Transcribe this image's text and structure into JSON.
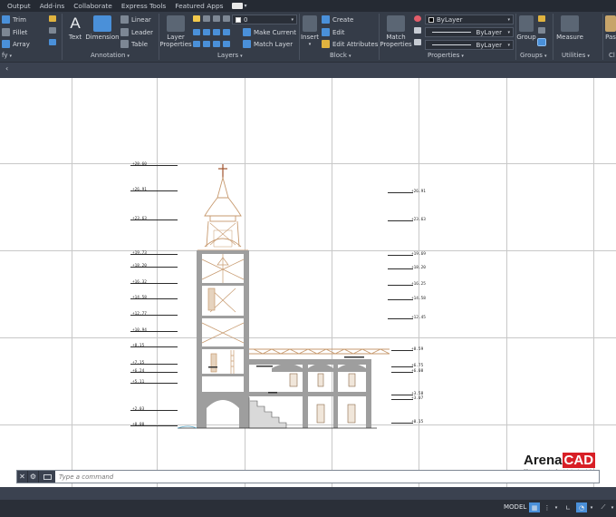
{
  "menu": {
    "tabs": [
      "Output",
      "Add-ins",
      "Collaborate",
      "Express Tools",
      "Featured Apps"
    ]
  },
  "ribbon": {
    "modify": {
      "label": "fy",
      "items": [
        "Trim",
        "Fillet",
        "Array"
      ]
    },
    "annotation": {
      "label": "Annotation",
      "text_label": "Text",
      "dimension_label": "Dimension",
      "items": [
        "Linear",
        "Leader",
        "Table"
      ]
    },
    "layers": {
      "label": "Layers",
      "layer_properties_label": "Layer\nProperties",
      "layer_value": "0",
      "make_current_label": "Make Current",
      "match_layer_label": "Match Layer"
    },
    "block": {
      "label": "Block",
      "insert_label": "Insert",
      "items": [
        "Create",
        "Edit",
        "Edit Attributes"
      ]
    },
    "properties": {
      "label": "Properties",
      "match_properties_label": "Match\nProperties",
      "color_value": "ByLayer",
      "linetype_value": "ByLayer",
      "lineweight_value": "ByLayer"
    },
    "groups": {
      "label": "Groups",
      "group_label": "Group"
    },
    "utilities": {
      "label": "Utilities",
      "measure_label": "Measure"
    },
    "clipboard": {
      "label": "Cl",
      "paste_label": "Pas"
    }
  },
  "drawing": {
    "elevations_left": [
      "+28.60",
      "+26.91",
      "+23.63",
      "+19.73",
      "+18.20",
      "+16.32",
      "+14.58",
      "+12.77",
      "+10.94",
      "+8.15",
      "+7.15",
      "+6.24",
      "+5.11",
      "+2.03",
      "+0.00"
    ],
    "elevations_right": [
      "+26.91",
      "+23.63",
      "+19.69",
      "+18.20",
      "+16.25",
      "+14.58",
      "+12.45",
      "+8.59",
      "+6.75",
      "+6.08",
      "+3.58",
      "+3.07",
      "+0.15"
    ]
  },
  "command_line": {
    "placeholder": "Type a command"
  },
  "logo": {
    "brand_part_1": "Arena",
    "brand_part_2": "CAD",
    "tagline": "3D laser scanning & point cloud modeling"
  },
  "status_bar": {
    "mode": "MODEL"
  },
  "colors": {
    "ribbon_bg": "#353c48",
    "canvas_bg": "#ffffff",
    "brand_red": "#d81f26",
    "structure_brown": "#c79a6f",
    "wall_gray": "#9e9e9e"
  }
}
